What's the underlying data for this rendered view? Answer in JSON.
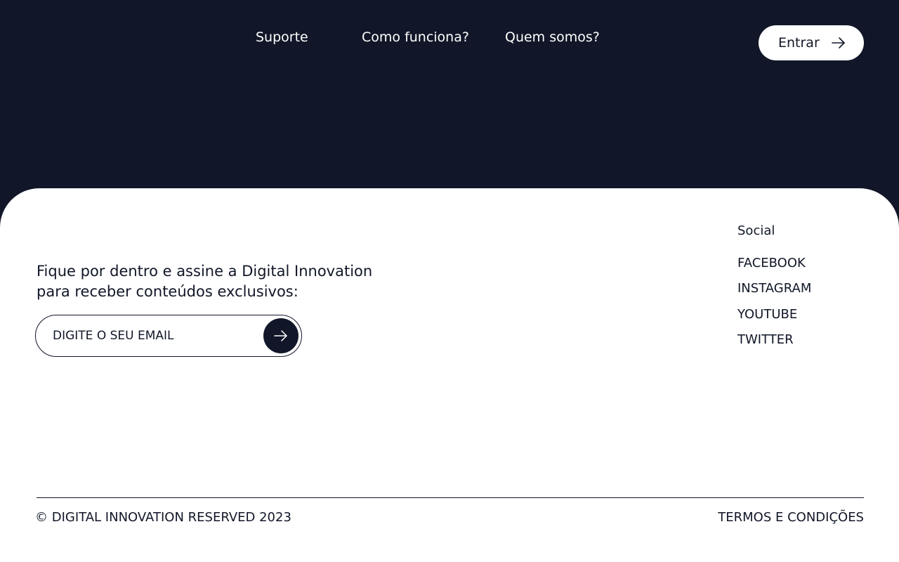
{
  "header": {
    "nav": [
      {
        "label": "Suporte"
      },
      {
        "label": "Como funciona?"
      },
      {
        "label": "Quem somos?"
      }
    ],
    "login_label": "Entrar",
    "login_icon": "arrow-right-icon"
  },
  "newsletter": {
    "line1": "Fique por dentro e assine a Digital Innovation",
    "line2": "para receber conteúdos exclusivos:",
    "email_placeholder": "DIGITE O SEU EMAIL",
    "submit_icon": "arrow-right-icon"
  },
  "social": {
    "title": "Social",
    "links": [
      {
        "label": "FACEBOOK"
      },
      {
        "label": "INSTAGRAM"
      },
      {
        "label": "YOUTUBE"
      },
      {
        "label": "TWITTER"
      }
    ]
  },
  "footer_bottom": {
    "copyright": "© DIGITAL INNOVATION RESERVED 2023",
    "terms": "TERMOS E CONDIÇÕES"
  },
  "colors": {
    "dark_navy": "#111728",
    "white": "#ffffff"
  }
}
